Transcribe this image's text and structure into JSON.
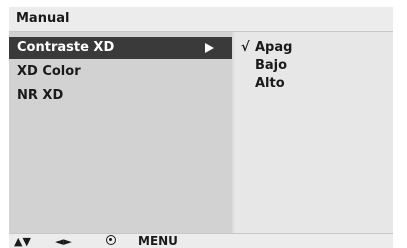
{
  "header": {
    "title": "Manual"
  },
  "menu": {
    "items": [
      {
        "label": "Contraste XD",
        "selected": true
      },
      {
        "label": "XD Color",
        "selected": false
      },
      {
        "label": "NR XD",
        "selected": false
      }
    ]
  },
  "submenu": {
    "check_mark": "√",
    "options": [
      {
        "label": "Apag",
        "checked": true
      },
      {
        "label": "Bajo",
        "checked": false
      },
      {
        "label": "Alto",
        "checked": false
      }
    ]
  },
  "footer": {
    "updown_icon": "▲▼",
    "leftright_icon": "◄►",
    "menu_label": "MENU"
  },
  "icons": {
    "selected_arrow": "arrow-right-icon",
    "ok": "ok-button-icon"
  },
  "colors": {
    "selected_background": "#3a3a3a",
    "left_panel": "#d2d2d2",
    "right_panel": "#e7e7e7"
  }
}
